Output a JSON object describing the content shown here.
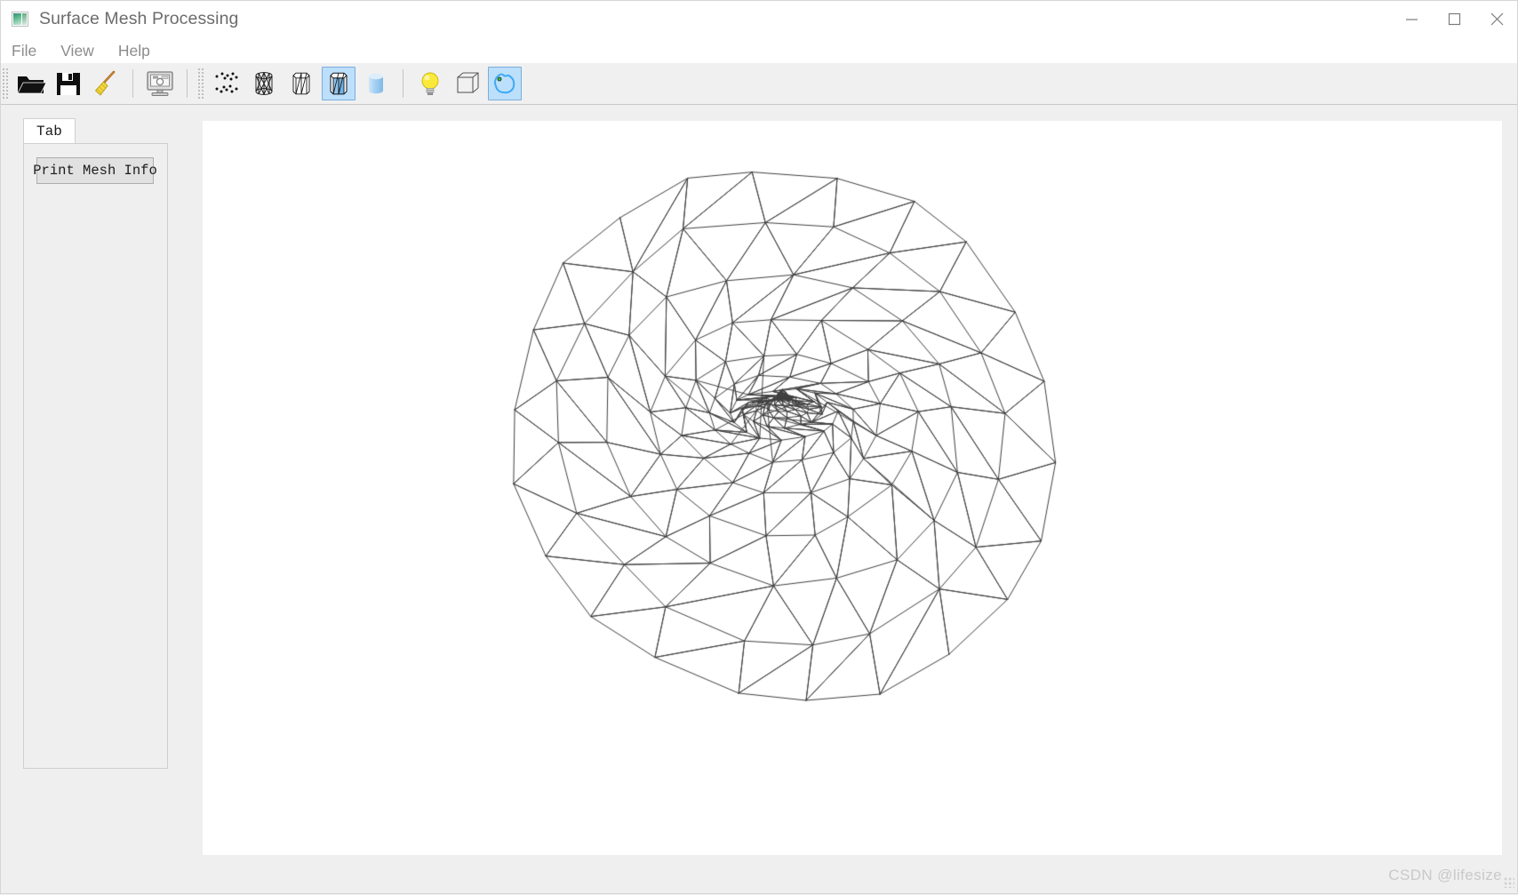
{
  "window": {
    "title": "Surface Mesh Processing",
    "app_icon": "app-window-icon",
    "controls": {
      "minimize": "—",
      "maximize": "☐",
      "close": "✕"
    }
  },
  "menu": {
    "items": [
      {
        "label": "File",
        "name": "menu-file"
      },
      {
        "label": "View",
        "name": "menu-view"
      },
      {
        "label": "Help",
        "name": "menu-help"
      }
    ]
  },
  "toolbar": {
    "groups": [
      {
        "buttons": [
          {
            "icon": "open-folder-icon",
            "label": "Open",
            "selected": false
          },
          {
            "icon": "save-floppy-icon",
            "label": "Save",
            "selected": false
          },
          {
            "icon": "broom-clear-icon",
            "label": "Clear",
            "selected": false
          }
        ]
      },
      {
        "buttons": [
          {
            "icon": "screenshot-monitor-icon",
            "label": "Snapshot",
            "selected": false
          }
        ]
      },
      {
        "buttons": [
          {
            "icon": "points-cloud-icon",
            "label": "Points",
            "selected": false
          },
          {
            "icon": "wireframe-hidden-icon",
            "label": "Wireframe",
            "selected": false
          },
          {
            "icon": "hidden-line-icon",
            "label": "Hidden Line",
            "selected": false
          },
          {
            "icon": "solid-wireframe-icon",
            "label": "Solid Wireframe",
            "selected": true
          },
          {
            "icon": "solid-smooth-icon",
            "label": "Solid Smooth",
            "selected": false
          }
        ]
      },
      {
        "buttons": [
          {
            "icon": "lightbulb-icon",
            "label": "Lighting",
            "selected": false
          },
          {
            "icon": "bounding-box-icon",
            "label": "Bounding Box",
            "selected": false
          },
          {
            "icon": "boundary-contour-icon",
            "label": "Boundary",
            "selected": true
          }
        ]
      }
    ]
  },
  "left_panel": {
    "tab_label": "Tab",
    "print_mesh_info_label": "Print Mesh Info"
  },
  "viewport": {
    "background": "#ffffff",
    "mesh_line_color": "#3f3f3f",
    "mesh_name": "triangulated-surface-mesh"
  },
  "status_bar": {
    "text": ""
  },
  "watermark": {
    "text": "CSDN @lifesize"
  },
  "colors": {
    "accent_selected": "#bcdffb",
    "accent_selected_border": "#7aaedd",
    "chrome": "#efefef",
    "title_text": "#6c6c6c",
    "menu_text": "#8c8c8c"
  }
}
